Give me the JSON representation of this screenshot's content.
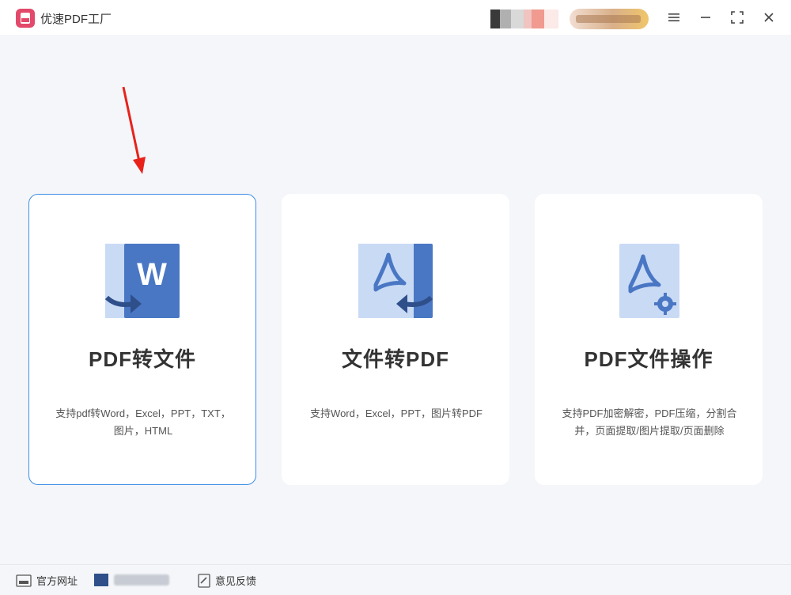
{
  "titlebar": {
    "app_title": "优速PDF工厂",
    "logo_icon": "pdf-logo-icon",
    "buttons": [
      "menu-icon",
      "minimize-icon",
      "maximize-icon",
      "close-icon"
    ]
  },
  "cards": [
    {
      "title": "PDF转文件",
      "desc_line1": "支持pdf转Word，Excel，PPT，TXT，",
      "desc_line2": "图片，HTML",
      "icon": "word-convert-icon"
    },
    {
      "title": "文件转PDF",
      "desc_line1": "支持Word，Excel，PPT，图片转PDF",
      "desc_line2": "",
      "icon": "pdf-convert-icon"
    },
    {
      "title": "PDF文件操作",
      "desc_line1": "支持PDF加密解密，PDF压缩，分割合",
      "desc_line2": "并，页面提取/图片提取/页面删除",
      "icon": "pdf-settings-icon"
    }
  ],
  "bottombar": {
    "website_label": "官方网址",
    "feedback_label": "意见反馈"
  },
  "colors": {
    "accent": "#3e8ee6",
    "icon_blue": "#4a77c4",
    "icon_light": "#c9daf5",
    "logo_red": "#e2496a",
    "arrow_red": "#e8221b"
  }
}
